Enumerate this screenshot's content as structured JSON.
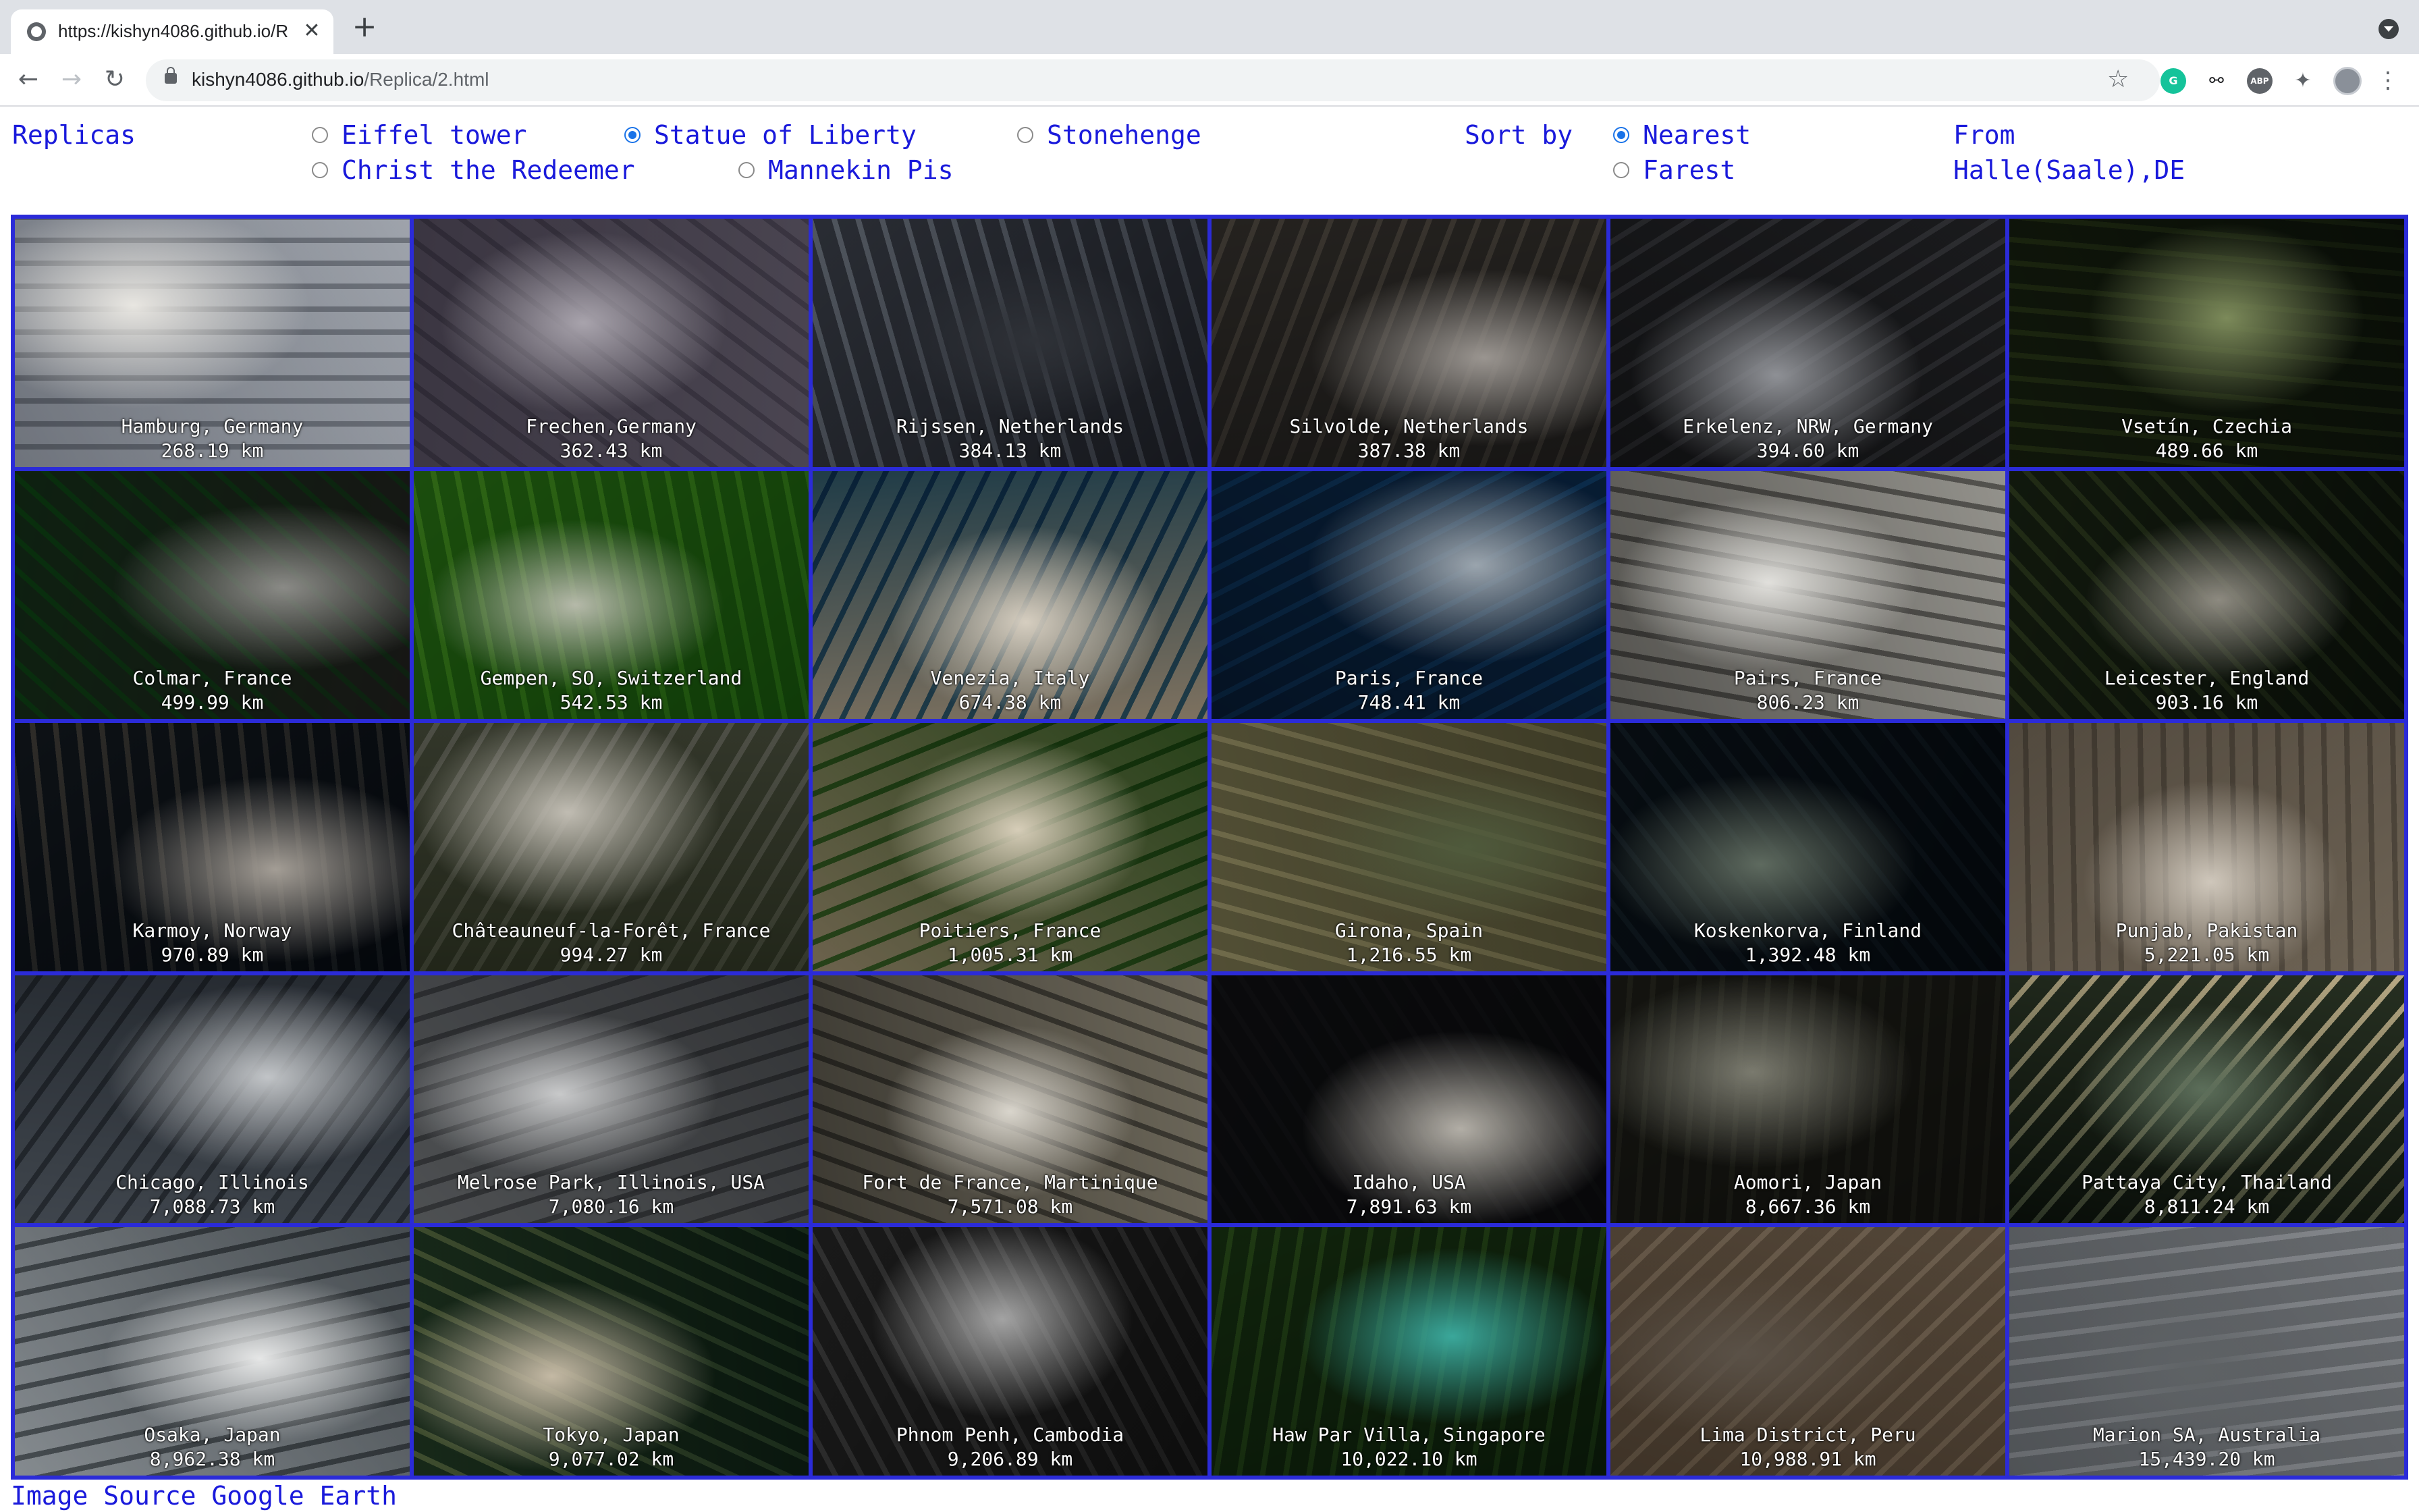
{
  "browser": {
    "tab_title": "https://kishyn4086.github.io/R",
    "url_host": "kishyn4086.github.io",
    "url_path": "/Replica/2.html"
  },
  "header": {
    "brand": "Replicas",
    "landmarks": [
      {
        "label": "Eiffel tower",
        "selected": false
      },
      {
        "label": "Statue of Liberty",
        "selected": true
      },
      {
        "label": "Stonehenge",
        "selected": false
      },
      {
        "label": "Christ the Redeemer",
        "selected": false
      },
      {
        "label": "Mannekin Pis",
        "selected": false
      }
    ],
    "sort_label": "Sort by",
    "sort_options": [
      {
        "label": "Nearest",
        "selected": true
      },
      {
        "label": "Farest",
        "selected": false
      }
    ],
    "from_label": "From",
    "from_value": "Halle(Saale),DE"
  },
  "cards": [
    {
      "place": "Hamburg, Germany",
      "distance": "268.19 km",
      "palette": [
        "#c9ccd1",
        "#8c9097",
        "#e8e6e1"
      ]
    },
    {
      "place": "Frechen,Germany",
      "distance": "362.43 km",
      "palette": [
        "#8a8590",
        "#6c6774",
        "#a8a3ac"
      ]
    },
    {
      "place": "Rijssen, Netherlands",
      "distance": "384.13 km",
      "palette": [
        "#4a4d55",
        "#8f949b",
        "#2f3238"
      ]
    },
    {
      "place": "Silvolde, Netherlands",
      "distance": "387.38 km",
      "palette": [
        "#4c4a48",
        "#7a756e",
        "#9a9590"
      ]
    },
    {
      "place": "Erkelenz, NRW, Germany",
      "distance": "394.60 km",
      "palette": [
        "#3e3f42",
        "#6b6c70",
        "#8e9095"
      ]
    },
    {
      "place": "Vsetín, Czechia",
      "distance": "489.66 km",
      "palette": [
        "#2f3a2a",
        "#55633f",
        "#7c8a5a"
      ]
    },
    {
      "place": "Colmar, France",
      "distance": "499.99 km",
      "palette": [
        "#4b4b48",
        "#2f6e3a",
        "#8a8a86"
      ]
    },
    {
      "place": "Gempen, SO, Switzerland",
      "distance": "542.53 km",
      "palette": [
        "#3f7a2e",
        "#6ea14a",
        "#b5b9a9"
      ]
    },
    {
      "place": "Venezia, Italy",
      "distance": "674.38 km",
      "palette": [
        "#b3aa9c",
        "#2d5a75",
        "#d6cec0"
      ]
    },
    {
      "place": "Paris, France",
      "distance": "748.41 km",
      "palette": [
        "#22445e",
        "#356a8a",
        "#9aa4ad"
      ]
    },
    {
      "place": "Pairs, France",
      "distance": "806.23 km",
      "palette": [
        "#c2c1bd",
        "#6f6e6b",
        "#e1e0dc"
      ]
    },
    {
      "place": "Leicester, England",
      "distance": "903.16 km",
      "palette": [
        "#2e3a2c",
        "#5d6a4b",
        "#8d8a80"
      ]
    },
    {
      "place": "Karmoy, Norway",
      "distance": "970.89 km",
      "palette": [
        "#1f2a36",
        "#6e6b66",
        "#a39d95"
      ]
    },
    {
      "place": "Châteauneuf-la-Forêt, France",
      "distance": "994.27 km",
      "palette": [
        "#5c6250",
        "#8d8e86",
        "#c0bcb2"
      ]
    },
    {
      "place": "Poitiers, France",
      "distance": "1,005.31 km",
      "palette": [
        "#a69e8c",
        "#3c6a2e",
        "#d6cdb8"
      ]
    },
    {
      "place": "Girona, Spain",
      "distance": "1,216.55 km",
      "palette": [
        "#7c7a62",
        "#a9a58a",
        "#4f5a3c"
      ]
    },
    {
      "place": "Koskenkorva, Finland",
      "distance": "1,392.48 km",
      "palette": [
        "#1e2b35",
        "#3b4a53",
        "#5e6a5f"
      ]
    },
    {
      "place": "Punjab, Pakistan",
      "distance": "5,221.05 km",
      "palette": [
        "#a79f93",
        "#7d766c",
        "#cfc7bb"
      ]
    },
    {
      "place": "Chicago, Illinois",
      "distance": "7,088.73 km",
      "palette": [
        "#7f858c",
        "#4a5057",
        "#c1c4c7"
      ]
    },
    {
      "place": "Melrose Park, Illinois, USA",
      "distance": "7,080.16 km",
      "palette": [
        "#8d8f91",
        "#5a5c5f",
        "#c8c9ca"
      ]
    },
    {
      "place": "Fort de France, Martinique",
      "distance": "7,571.08 km",
      "palette": [
        "#a7a398",
        "#5d5b55",
        "#d9d5cc"
      ]
    },
    {
      "place": "Idaho, USA",
      "distance": "7,891.63 km",
      "palette": [
        "#2c2d31",
        "#3a3b3f",
        "#b2aea6"
      ]
    },
    {
      "place": "Aomori, Japan",
      "distance": "8,667.36 km",
      "palette": [
        "#3a3a34",
        "#55564c",
        "#7a7a6e"
      ]
    },
    {
      "place": "Pattaya City, Thailand",
      "distance": "8,811.24 km",
      "palette": [
        "#2d3a2e",
        "#d9d0b8",
        "#5c6e5a"
      ]
    },
    {
      "place": "Osaka, Japan",
      "distance": "8,962.38 km",
      "palette": [
        "#b8bcbf",
        "#61676b",
        "#e6e7e7"
      ]
    },
    {
      "place": "Tokyo, Japan",
      "distance": "9,077.02 km",
      "palette": [
        "#2f4a3a",
        "#7f8c6d",
        "#c4b9a4"
      ]
    },
    {
      "place": "Phnom Penh, Cambodia",
      "distance": "9,206.89 km",
      "palette": [
        "#3a3a3a",
        "#707070",
        "#a3a3a3"
      ]
    },
    {
      "place": "Haw Par Villa, Singapore",
      "distance": "10,022.10 km",
      "palette": [
        "#2e4a2c",
        "#5a7a46",
        "#3aa79a"
      ]
    },
    {
      "place": "Lima District, Peru",
      "distance": "10,988.91 km",
      "palette": [
        "#7e7264",
        "#a79c8e",
        "#5a5147"
      ]
    },
    {
      "place": "Marion SA, Australia",
      "distance": "15,439.20 km",
      "palette": [
        "#8e9194",
        "#b8babd",
        "#5e6265"
      ]
    }
  ],
  "footer": {
    "credit": "Image Source Google Earth"
  }
}
